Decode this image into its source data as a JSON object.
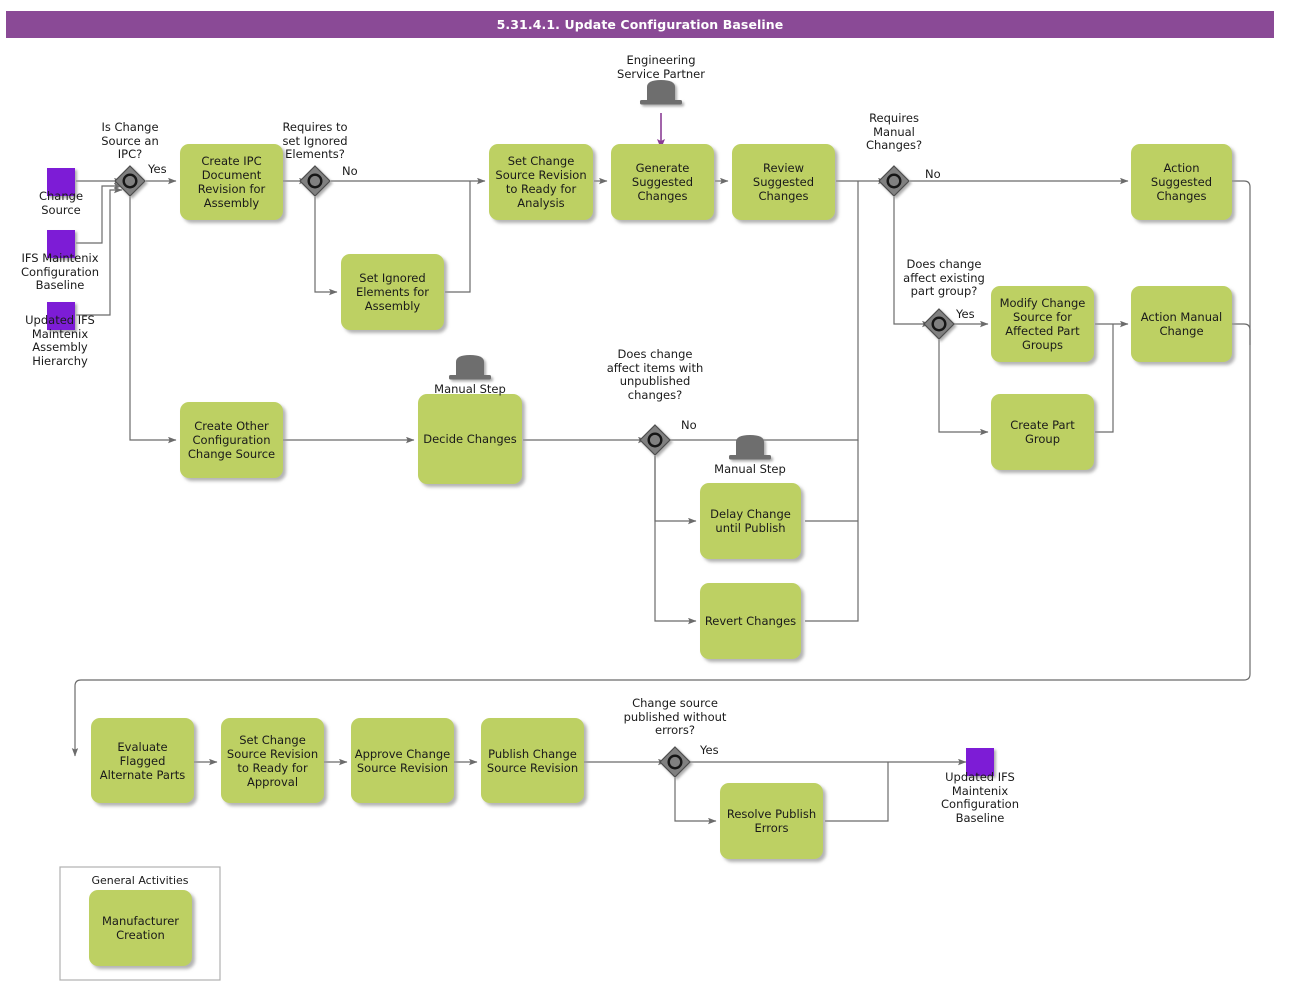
{
  "header": {
    "title": "5.31.4.1. Update Configuration Baseline"
  },
  "colors": {
    "header_bar": "#8a4a96",
    "task_fill": "#bdd063",
    "data_object_fill": "#7d1ad6",
    "gateway_fill": "#808080",
    "gateway_stroke": "#404040",
    "connector": "#6b6b6b",
    "message_flow": "#8a3d95",
    "actor_icon": "#6e6e6e",
    "group_border": "#b0b0b0",
    "text": "#1a1a1a"
  },
  "data_objects": [
    {
      "id": "do-change-source",
      "label": "Change\nSource"
    },
    {
      "id": "do-ifs-baseline",
      "label": "IFS Maintenix\nConfiguration\nBaseline"
    },
    {
      "id": "do-updated-hierarchy",
      "label": "Updated IFS\nMaintenix\nAssembly\nHierarchy"
    },
    {
      "id": "do-updated-baseline",
      "label": "Updated IFS\nMaintenix\nConfiguration\nBaseline"
    }
  ],
  "gateways": [
    {
      "id": "gw-is-ipc",
      "label": "Is Change\nSource an\nIPC?"
    },
    {
      "id": "gw-requires-ignored",
      "label": "Requires to\nset Ignored\nElements?"
    },
    {
      "id": "gw-requires-manual",
      "label": "Requires\nManual\nChanges?"
    },
    {
      "id": "gw-affect-part-group",
      "label": "Does change\naffect existing\npart group?"
    },
    {
      "id": "gw-unpublished",
      "label": "Does change\naffect items with\nunpublished\nchanges?"
    },
    {
      "id": "gw-published-ok",
      "label": "Change source\npublished without\nerrors?"
    }
  ],
  "flow_labels": [
    {
      "id": "flow-yes-ipc",
      "text": "Yes"
    },
    {
      "id": "flow-no-ignored",
      "text": "No"
    },
    {
      "id": "flow-no-manual",
      "text": "No"
    },
    {
      "id": "flow-yes-part-group",
      "text": "Yes"
    },
    {
      "id": "flow-no-unpublished",
      "text": "No"
    },
    {
      "id": "flow-yes-published",
      "text": "Yes"
    }
  ],
  "actors": [
    {
      "id": "actor-engineering-service-partner",
      "label": "Engineering\nService Partner",
      "position": "above"
    },
    {
      "id": "actor-manual-step-decide",
      "label": "Manual Step",
      "position": "below"
    },
    {
      "id": "actor-manual-step-delay",
      "label": "Manual Step",
      "position": "below"
    }
  ],
  "tasks": [
    {
      "id": "task-create-ipc-doc",
      "label": "Create IPC\nDocument\nRevision  for\nAssembly"
    },
    {
      "id": "task-set-ignored-elements",
      "label": "Set Ignored\nElements for\nAssembly"
    },
    {
      "id": "task-set-ready-analysis",
      "label": "Set Change\nSource Revision\nto Ready for\nAnalysis"
    },
    {
      "id": "task-generate-suggested",
      "label": "Generate\nSuggested\nChanges"
    },
    {
      "id": "task-review-suggested",
      "label": "Review\nSuggested\nChanges"
    },
    {
      "id": "task-action-suggested",
      "label": "Action\nSuggested\nChanges"
    },
    {
      "id": "task-modify-change-source",
      "label": "Modify Change\nSource for\nAffected Part\nGroups"
    },
    {
      "id": "task-action-manual-change",
      "label": "Action Manual\nChange"
    },
    {
      "id": "task-create-part-group",
      "label": "Create Part\nGroup"
    },
    {
      "id": "task-create-other-source",
      "label": "Create Other\nConfiguration\nChange Source"
    },
    {
      "id": "task-decide-changes",
      "label": "Decide Changes"
    },
    {
      "id": "task-delay-change",
      "label": "Delay Change\nuntil Publish"
    },
    {
      "id": "task-revert-changes",
      "label": "Revert Changes"
    },
    {
      "id": "task-evaluate-flagged",
      "label": "Evaluate\nFlagged\nAlternate Parts"
    },
    {
      "id": "task-set-ready-approval",
      "label": "Set Change\nSource Revision\nto Ready for\nApproval"
    },
    {
      "id": "task-approve-revision",
      "label": "Approve Change\nSource Revision"
    },
    {
      "id": "task-publish-revision",
      "label": "Publish Change\nSource Revision"
    },
    {
      "id": "task-resolve-publish-errors",
      "label": "Resolve Publish\nErrors"
    },
    {
      "id": "task-manufacturer-creation",
      "label": "Manufacturer\nCreation"
    }
  ],
  "groups": [
    {
      "id": "group-general-activities",
      "title": "General Activities"
    }
  ]
}
